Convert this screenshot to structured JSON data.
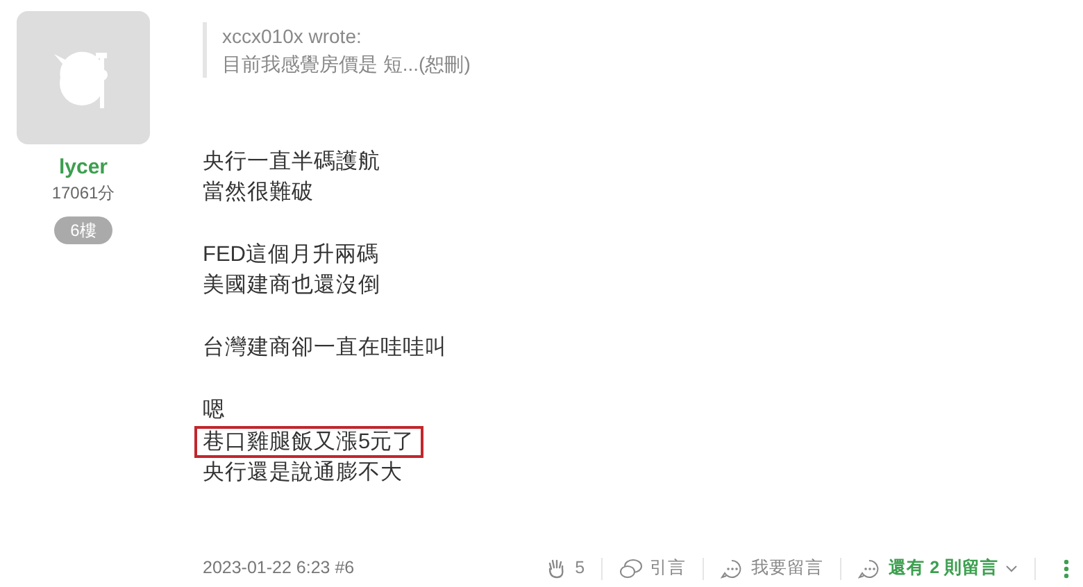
{
  "author": {
    "name": "lycer",
    "score": "17061分",
    "floor": "6樓"
  },
  "quote": {
    "author": "xccx010x wrote:",
    "excerpt": "目前我感覺房價是 短...(恕刪)"
  },
  "paragraphs": [
    [
      {
        "text": "央行一直半碼護航",
        "boxed": false
      },
      {
        "text": "當然很難破",
        "boxed": false
      }
    ],
    [
      {
        "text": "FED這個月升兩碼",
        "boxed": false
      },
      {
        "text": "美國建商也還沒倒",
        "boxed": false
      }
    ],
    [
      {
        "text": "台灣建商卻一直在哇哇叫",
        "boxed": false
      }
    ],
    [
      {
        "text": "嗯",
        "boxed": false
      },
      {
        "text": "巷口雞腿飯又漲5元了",
        "boxed": true
      },
      {
        "text": "央行還是說通膨不大",
        "boxed": false
      }
    ]
  ],
  "footer": {
    "timestamp": "2023-01-22 6:23 #6",
    "likes": "5",
    "quote": "引言",
    "reply": "我要留言",
    "more_comments": "還有 2 則留言"
  }
}
